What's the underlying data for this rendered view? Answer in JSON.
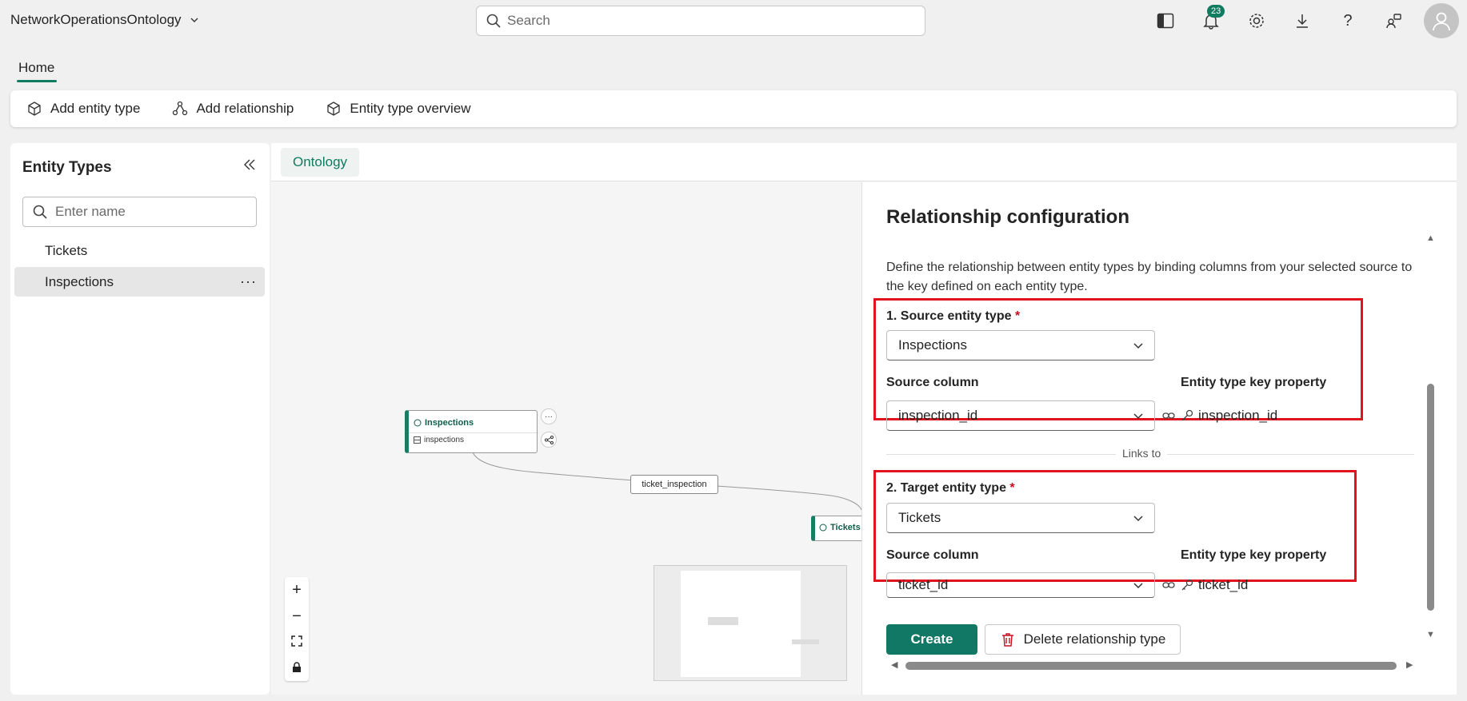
{
  "app": {
    "title": "NetworkOperationsOntology"
  },
  "search": {
    "placeholder": "Search"
  },
  "notifications": {
    "count": "23"
  },
  "home_tab": {
    "label": "Home"
  },
  "ribbon": {
    "add_entity_type": "Add entity type",
    "add_relationship": "Add relationship",
    "entity_type_overview": "Entity type overview"
  },
  "left_panel": {
    "title": "Entity Types",
    "search_placeholder": "Enter name",
    "items": [
      {
        "label": "Tickets",
        "selected": false
      },
      {
        "label": "Inspections",
        "selected": true
      }
    ]
  },
  "center": {
    "tab_label": "Ontology"
  },
  "canvas": {
    "nodes": [
      {
        "title": "Inspections",
        "subtitle": "inspections"
      },
      {
        "title": "Tickets"
      }
    ],
    "relationship_label": "ticket_inspection",
    "zoom_controls": [
      "+",
      "−"
    ]
  },
  "config": {
    "title": "Relationship configuration",
    "description": "Define the relationship between entity types by binding columns from your selected source to the key defined on each entity type.",
    "source": {
      "label": "1. Source entity type",
      "required_mark": "*",
      "value": "Inspections",
      "column_label": "Source column",
      "column_value": "inspection_id",
      "key_label": "Entity type key property",
      "key_value": "inspection_id"
    },
    "links_to": "Links to",
    "target": {
      "label": "2. Target entity type",
      "required_mark": "*",
      "value": "Tickets",
      "column_label": "Source column",
      "column_value": "ticket_id",
      "key_label": "Entity type key property",
      "key_value": "ticket_id"
    },
    "create_label": "Create",
    "delete_label": "Delete relationship type"
  },
  "colors": {
    "accent": "#117865",
    "highlight": "#e0141e",
    "badge": "#0f7b5f"
  }
}
